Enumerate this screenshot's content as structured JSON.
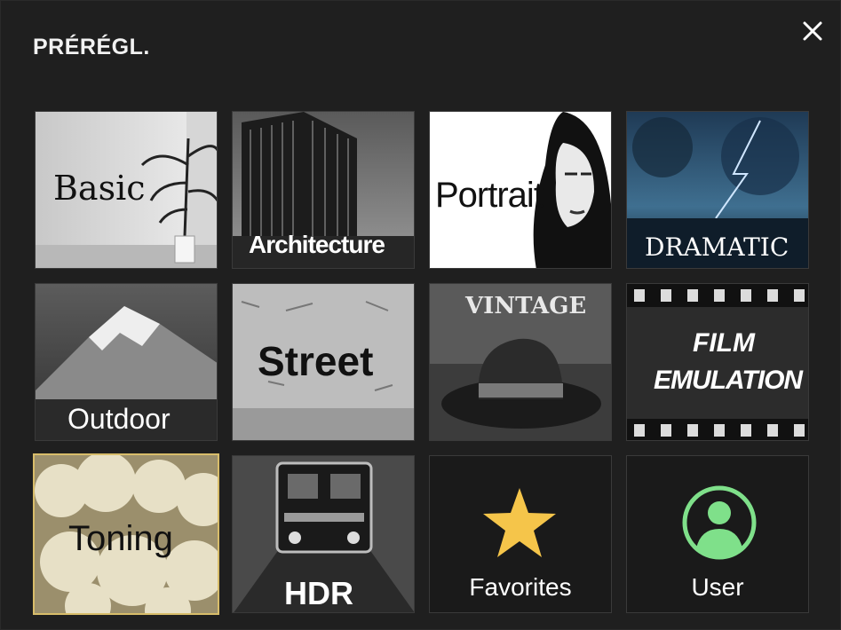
{
  "dialog": {
    "title": "PRÉRÉGL.",
    "close_icon": "close-icon"
  },
  "tiles": [
    {
      "label": "Basic"
    },
    {
      "label": "Architecture"
    },
    {
      "label": "Portrait"
    },
    {
      "label": "Dramatic"
    },
    {
      "label": "Outdoor"
    },
    {
      "label": "Street"
    },
    {
      "label": "VINTAGE"
    },
    {
      "label_line1": "FILM",
      "label_line2": "EMULATION"
    },
    {
      "label": "Toning",
      "selected": true
    },
    {
      "label": "HDR"
    },
    {
      "label": "Favorites",
      "icon": "star-icon"
    },
    {
      "label": "User",
      "icon": "user-icon"
    }
  ],
  "colors": {
    "background": "#1f1f1f",
    "selected_border": "#d8bd6a",
    "star": "#f5c54a",
    "user_icon": "#7fe08a"
  }
}
